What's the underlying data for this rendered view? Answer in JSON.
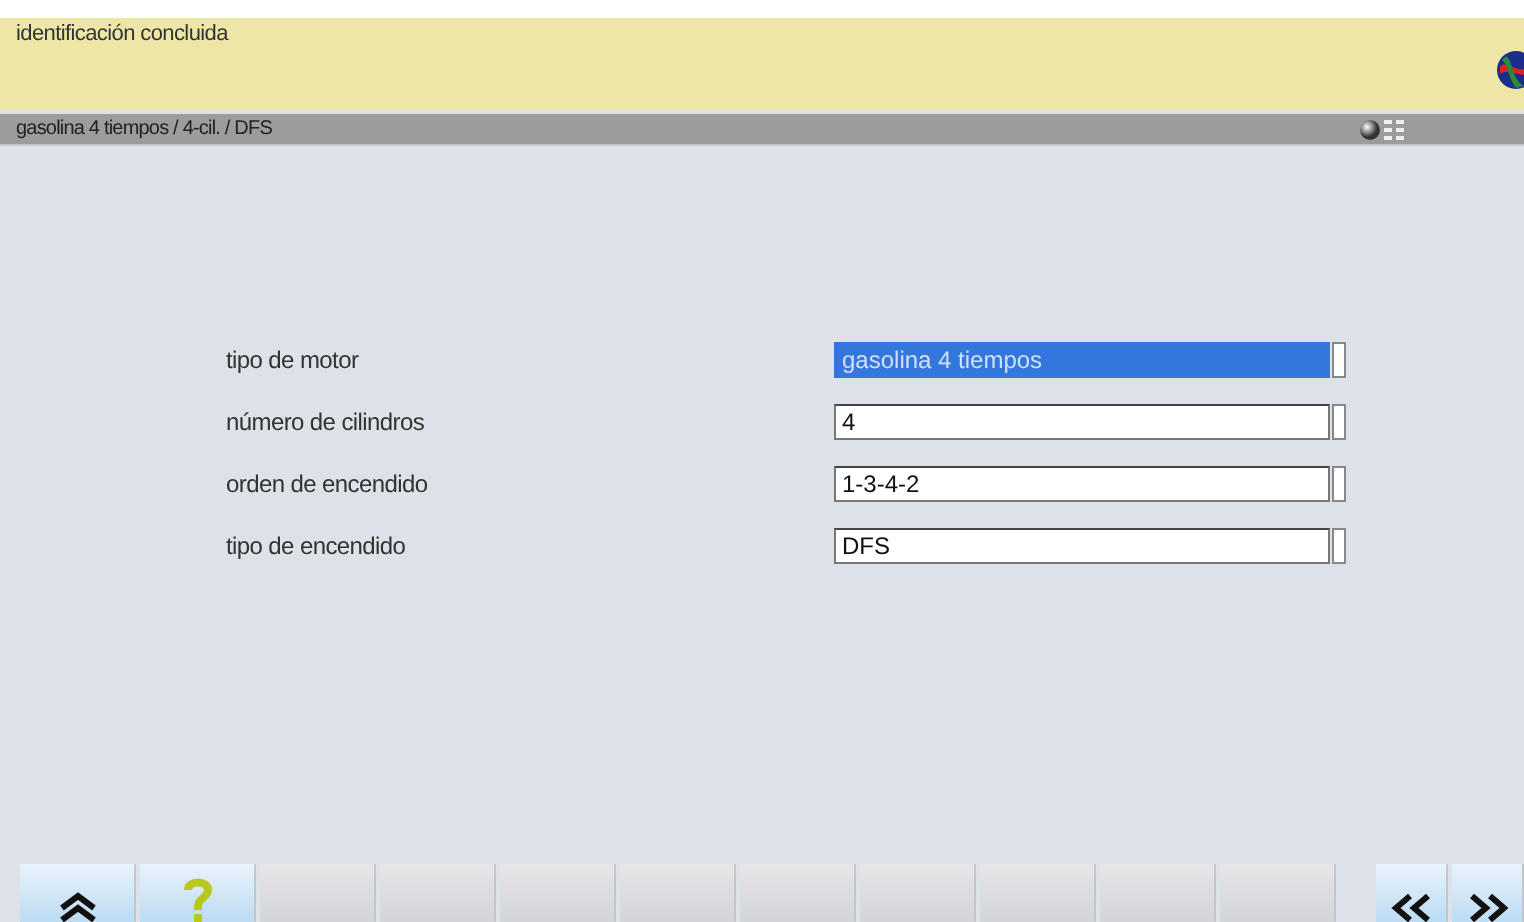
{
  "header": {
    "message": "identificación concluida"
  },
  "status_bar": {
    "text": "gasolina 4 tiempos /  4-cil. / DFS"
  },
  "fields": [
    {
      "label": "tipo de motor",
      "value": "gasolina 4 tiempos",
      "selected": true
    },
    {
      "label": "número de cilindros",
      "value": "4",
      "selected": false
    },
    {
      "label": "orden de encendido",
      "value": "1-3-4-2",
      "selected": false
    },
    {
      "label": "tipo de encendido",
      "value": "DFS",
      "selected": false
    }
  ],
  "toolbar": [
    {
      "kind": "up",
      "active": true
    },
    {
      "kind": "help",
      "active": true
    },
    {
      "kind": "empty",
      "active": false
    },
    {
      "kind": "empty",
      "active": false
    },
    {
      "kind": "empty",
      "active": false
    },
    {
      "kind": "empty",
      "active": false
    },
    {
      "kind": "empty",
      "active": false
    },
    {
      "kind": "empty",
      "active": false
    },
    {
      "kind": "empty",
      "active": false
    },
    {
      "kind": "empty",
      "active": false
    },
    {
      "kind": "empty",
      "active": false
    },
    {
      "kind": "back",
      "active": true
    },
    {
      "kind": "next",
      "active": true
    }
  ]
}
